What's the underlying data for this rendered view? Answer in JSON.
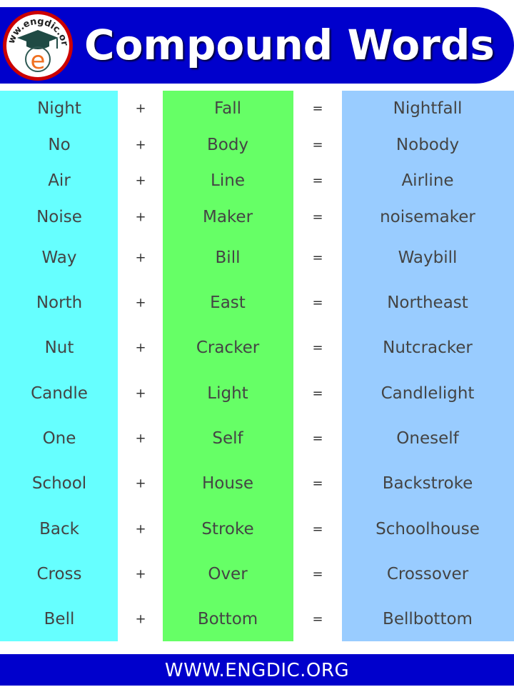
{
  "header": {
    "title": "Compound Words",
    "logo_text": "www.engdic.org",
    "logo_letter": "e"
  },
  "rows": [
    {
      "first": "Night",
      "plus": "+",
      "second": "Fall",
      "equals": "=",
      "result": "Nightfall"
    },
    {
      "first": "No",
      "plus": "+",
      "second": "Body",
      "equals": "=",
      "result": "Nobody"
    },
    {
      "first": "Air",
      "plus": "+",
      "second": "Line",
      "equals": "=",
      "result": "Airline"
    },
    {
      "first": "Noise",
      "plus": "+",
      "second": "Maker",
      "equals": "=",
      "result": "noisemaker"
    },
    {
      "first": "Way",
      "plus": "+",
      "second": "Bill",
      "equals": "=",
      "result": "Waybill"
    },
    {
      "first": "North",
      "plus": "+",
      "second": "East",
      "equals": "=",
      "result": "Northeast"
    },
    {
      "first": "Nut",
      "plus": "+",
      "second": "Cracker",
      "equals": "=",
      "result": "Nutcracker"
    },
    {
      "first": "Candle",
      "plus": "+",
      "second": "Light",
      "equals": "=",
      "result": "Candlelight"
    },
    {
      "first": "One",
      "plus": "+",
      "second": "Self",
      "equals": "=",
      "result": "Oneself"
    },
    {
      "first": "School",
      "plus": "+",
      "second": "House",
      "equals": "=",
      "result": "Backstroke"
    },
    {
      "first": "Back",
      "plus": "+",
      "second": "Stroke",
      "equals": "=",
      "result": "Schoolhouse"
    },
    {
      "first": "Cross",
      "plus": "+",
      "second": "Over",
      "equals": "=",
      "result": "Crossover"
    },
    {
      "first": "Bell",
      "plus": "+",
      "second": "Bottom",
      "equals": "=",
      "result": "Bellbottom"
    }
  ],
  "footer": {
    "url": "WWW.ENGDIC.ORG"
  },
  "colors": {
    "brand_blue": "#0000CC",
    "column_first": "#66FFFF",
    "column_second": "#66FF66",
    "column_result": "#99CCFF",
    "logo_ring": "#CC0000",
    "logo_e": "#F07020"
  }
}
